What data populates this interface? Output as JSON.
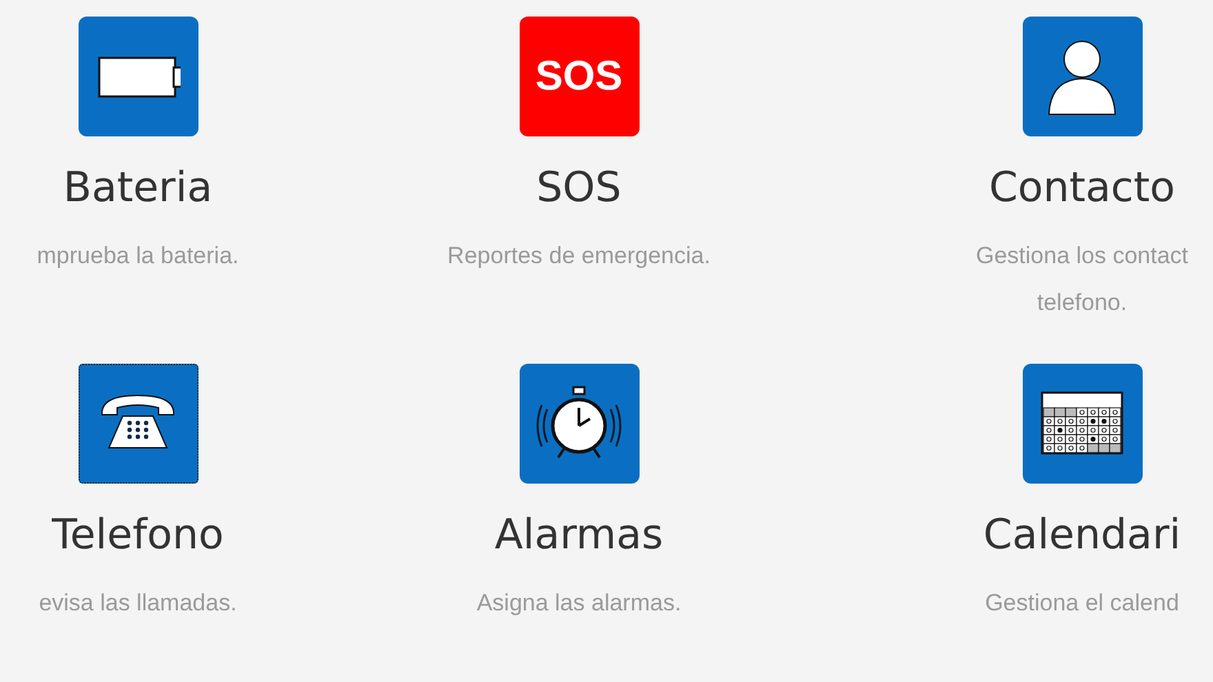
{
  "features": [
    {
      "icon": {
        "kind": "battery",
        "color": "#0a6fc2"
      },
      "title": "Bateria",
      "description": [
        "mprueba la bateria."
      ],
      "focused": false
    },
    {
      "icon": {
        "kind": "sos",
        "color": "#ff0000",
        "text": "SOS"
      },
      "title": "SOS",
      "description": [
        "Reportes de emergencia."
      ],
      "focused": false
    },
    {
      "icon": {
        "kind": "person",
        "color": "#0a6fc2"
      },
      "title": "Contacto",
      "description": [
        "Gestiona los contact",
        "telefono."
      ],
      "focused": false
    },
    {
      "icon": {
        "kind": "phone",
        "color": "#0a6fc2"
      },
      "title": "Telefono",
      "description": [
        "evisa las llamadas."
      ],
      "focused": true
    },
    {
      "icon": {
        "kind": "alarm",
        "color": "#0a6fc2"
      },
      "title": "Alarmas",
      "description": [
        "Asigna las alarmas."
      ],
      "focused": false
    },
    {
      "icon": {
        "kind": "calendar",
        "color": "#0a6fc2"
      },
      "title": "Calendari",
      "description": [
        "Gestiona el calend"
      ],
      "focused": false
    }
  ]
}
